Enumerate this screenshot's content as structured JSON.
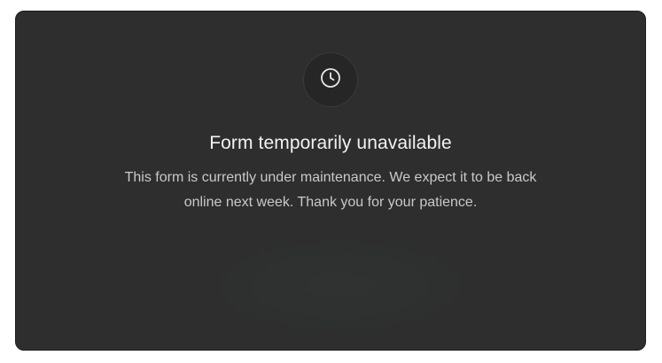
{
  "notice": {
    "icon": "clock-icon",
    "title": "Form temporarily unavailable",
    "message": "This form is currently under maintenance. We expect it to be back online next week. Thank you for your patience."
  },
  "colors": {
    "card_background": "#2e2e2e",
    "icon_circle": "#262626",
    "title_text": "#f2f2f2",
    "body_text": "#c9c9c9"
  }
}
